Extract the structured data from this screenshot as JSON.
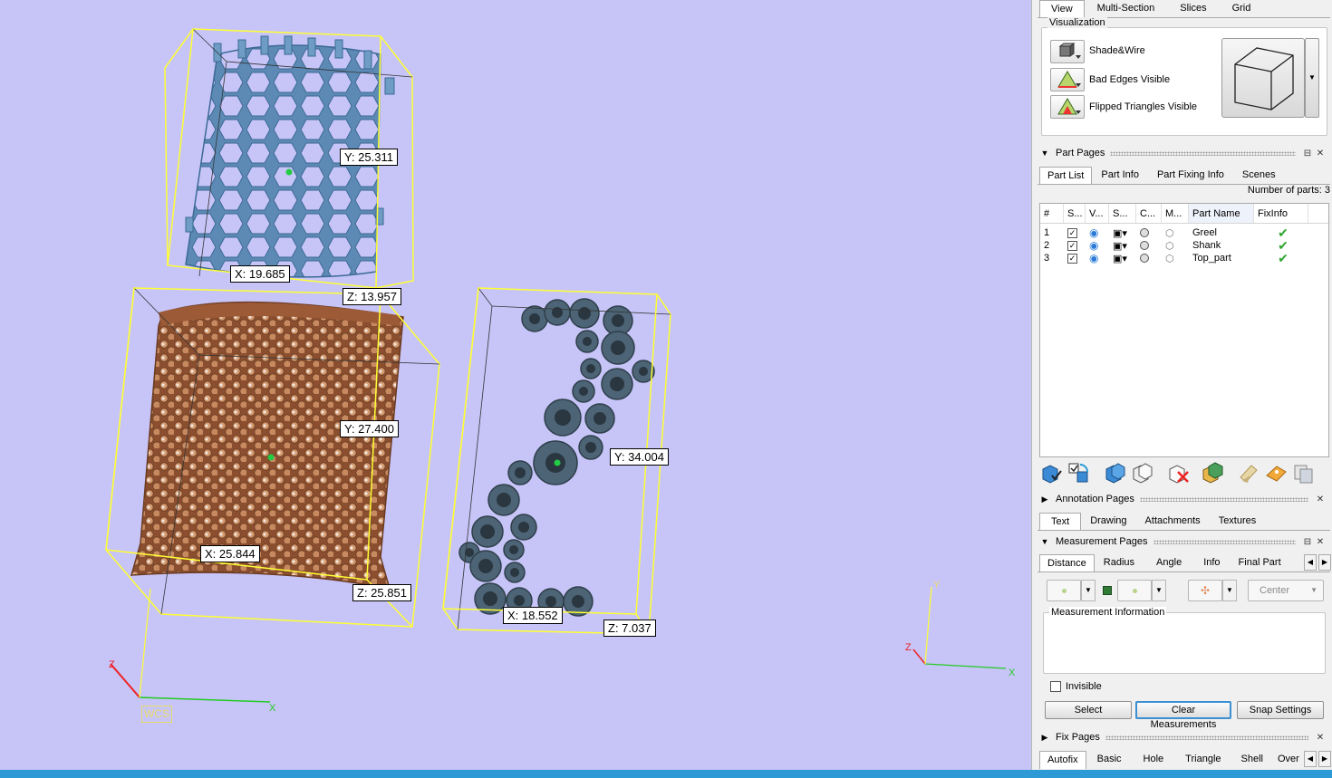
{
  "viewport": {
    "dims": {
      "top_part_y": "Y: 25.311",
      "top_part_x": "X: 19.685",
      "top_part_z": "Z: 13.957",
      "shank_y": "Y: 27.400",
      "shank_x": "X: 25.844",
      "shank_z": "Z: 25.851",
      "greel_y": "Y: 34.004",
      "greel_x": "X: 18.552",
      "greel_z": "Z: 7.037"
    },
    "wcs_label": "WCS",
    "axis_x": "X",
    "axis_y": "Y",
    "axis_z": "Z"
  },
  "top_tabs": [
    "View",
    "Multi-Section",
    "Slices",
    "Grid"
  ],
  "visualization": {
    "legend": "Visualization",
    "items": [
      "Shade&Wire",
      "Bad Edges Visible",
      "Flipped Triangles Visible"
    ]
  },
  "part_pages": {
    "title": "Part Pages",
    "tabs": [
      "Part List",
      "Part Info",
      "Part Fixing Info",
      "Scenes"
    ],
    "count_label": "Number of parts: 3",
    "columns": [
      "#",
      "S...",
      "V...",
      "S...",
      "C...",
      "M...",
      "Part Name",
      "FixInfo"
    ],
    "rows": [
      {
        "num": "1",
        "name": "Greel"
      },
      {
        "num": "2",
        "name": "Shank"
      },
      {
        "num": "3",
        "name": "Top_part"
      }
    ]
  },
  "annotation_pages": {
    "title": "Annotation Pages",
    "tabs": [
      "Text",
      "Drawing",
      "Attachments",
      "Textures"
    ]
  },
  "measurement_pages": {
    "title": "Measurement Pages",
    "tabs": [
      "Distance",
      "Radius",
      "Angle",
      "Info",
      "Final Part"
    ],
    "snap_mode": "Center",
    "info_legend": "Measurement Information",
    "invisible_label": "Invisible",
    "buttons": [
      "Select",
      "Clear Measurements",
      "Snap Settings"
    ]
  },
  "fix_pages": {
    "title": "Fix Pages",
    "tabs": [
      "Autofix",
      "Basic",
      "Hole",
      "Triangle",
      "Shell",
      "Over"
    ]
  },
  "colors": {
    "viewport_bg": "#c7c4f8",
    "bbox": "#ffff33",
    "top_part": "#6e9cc4",
    "shank": "#9b5a35",
    "greel": "#4c6475",
    "taskbar": "#2d9ad6"
  }
}
